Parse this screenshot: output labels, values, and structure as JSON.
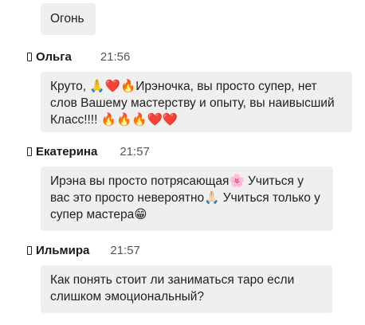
{
  "messages": [
    {
      "author": "",
      "time": "",
      "text": "Огонь"
    },
    {
      "author": "Ольга",
      "time": "21:56",
      "text": "Круто, 🙏❤️🔥Ирэночка, вы просто супер, нет слов Вашему мастерству и опыту, вы наивысший Класс!!!! 🔥🔥🔥❤️❤️"
    },
    {
      "author": "Екатерина",
      "time": "21:57",
      "text": "Ирэна вы просто потрясающая🌸 Учиться у вас это просто невероятно🙏🏻 Учиться только у супер мастера😁"
    },
    {
      "author": "Ильмира",
      "time": "21:57",
      "text": "Как понять стоит ли заниматься таро если слишком эмоциональный?"
    }
  ]
}
